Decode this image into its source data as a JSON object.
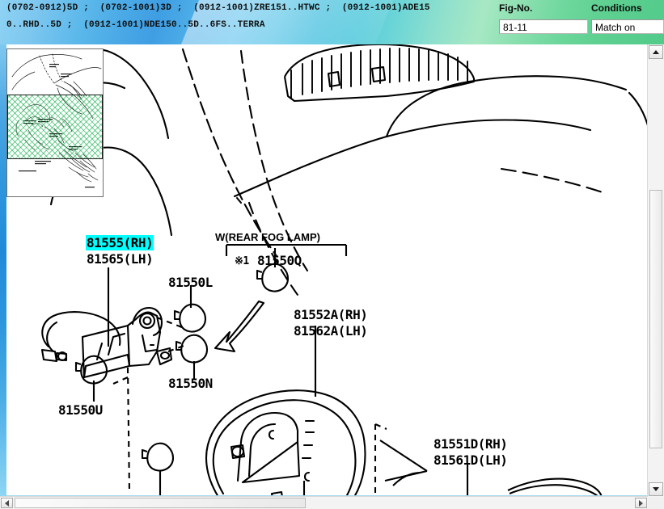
{
  "header": {
    "conditions_line_1": "(0702-0912)5D ;  (0702-1001)3D ;  (0912-1001)ZRE151..HTWC ;  (0912-1001)ADE15",
    "conditions_line_2": "0..RHD..5D ;  (0912-1001)NDE150..5D..6FS..TERRA",
    "fig_no_label": "Fig-No.",
    "fig_no_value": "81-11",
    "conditions_label": "Conditions",
    "conditions_value": "Match on",
    "gradient_left": "#4aa9e6",
    "gradient_mid": "#4fc3e0",
    "gradient_right": "#52cb8a"
  },
  "diagram": {
    "title": "Rear Combination Lamp Assembly",
    "selection_highlight_color": "#00ffff",
    "note": "W(REAR FOG LAMP)",
    "asterisk_mark": "※1",
    "labels": [
      {
        "id": "l-81555rh",
        "text": "81555(RH)",
        "selected": true
      },
      {
        "id": "l-81565lh",
        "text": "81565(LH)",
        "selected": false
      },
      {
        "id": "l-81550l",
        "text": "81550L",
        "selected": false
      },
      {
        "id": "l-81550q",
        "text": "81550Q",
        "selected": false
      },
      {
        "id": "l-81552arh",
        "text": "81552A(RH)",
        "selected": false
      },
      {
        "id": "l-81562alh",
        "text": "81562A(LH)",
        "selected": false
      },
      {
        "id": "l-81550n",
        "text": "81550N",
        "selected": false
      },
      {
        "id": "l-81550u",
        "text": "81550U",
        "selected": false
      },
      {
        "id": "l-81551drh",
        "text": "81551D(RH)",
        "selected": false
      },
      {
        "id": "l-81561dlh",
        "text": "81561D(LH)",
        "selected": false
      }
    ]
  },
  "thumbnail": {
    "viewport_fill": "#00aa3c"
  },
  "scrollbars": {
    "v_up_icon": "caret-up",
    "v_down_icon": "caret-down",
    "h_left_icon": "caret-left",
    "h_right_icon": "caret-right"
  }
}
